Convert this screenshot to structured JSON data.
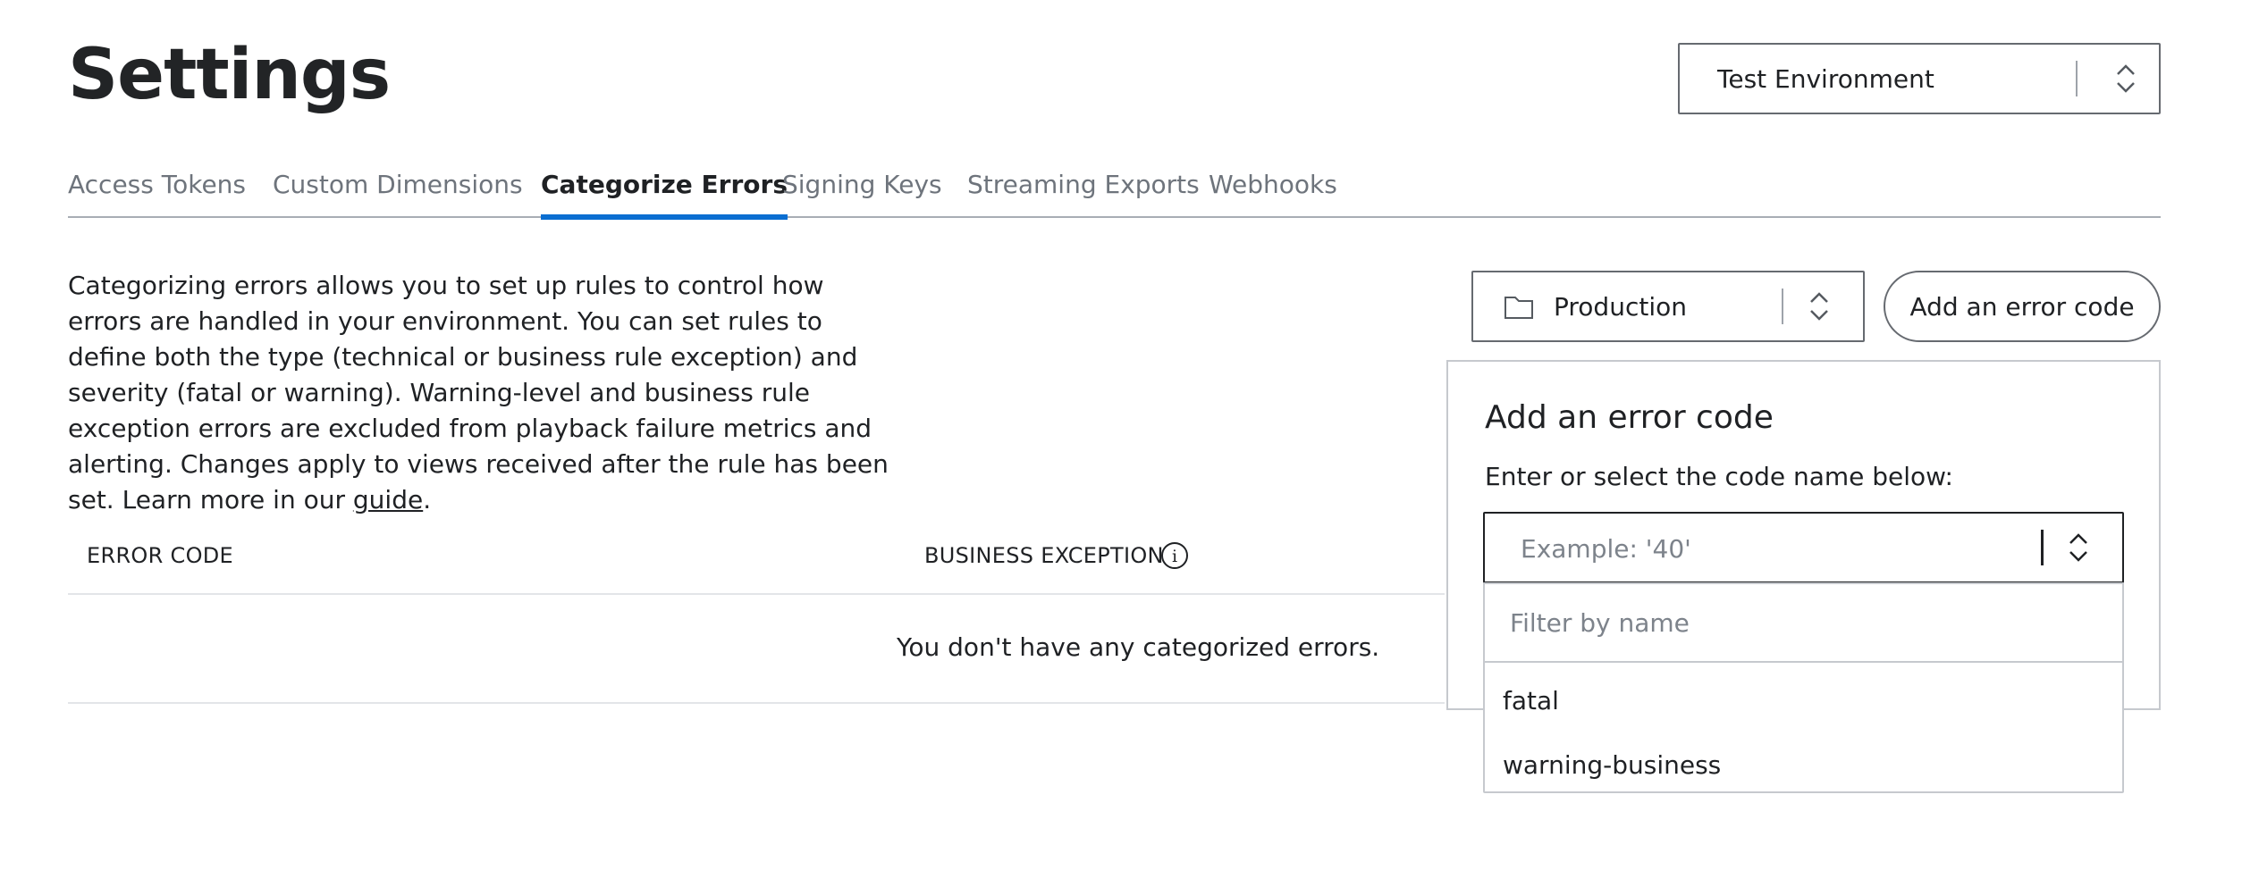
{
  "header": {
    "title": "Settings",
    "environment_select": {
      "value": "Test Environment"
    }
  },
  "tabs": [
    {
      "label": "Access Tokens",
      "active": false
    },
    {
      "label": "Custom Dimensions",
      "active": false
    },
    {
      "label": "Categorize Errors",
      "active": true
    },
    {
      "label": "Signing Keys",
      "active": false
    },
    {
      "label": "Streaming Exports",
      "active": false
    },
    {
      "label": "Webhooks",
      "active": false
    }
  ],
  "description": {
    "text": "Categorizing errors allows you to set up rules to control how errors are handled in your environment. You can set rules to define both the type (technical or business rule exception) and severity (fatal or warning). Warning-level and business rule exception errors are excluded from playback failure metrics and alerting. Changes apply to views received after the rule has been set. Learn more in our ",
    "link_text": "guide",
    "end": "."
  },
  "table": {
    "columns": [
      "ERROR CODE",
      "BUSINESS EXCEPTION"
    ],
    "empty_message": "You don't have any categorized errors."
  },
  "toolbar": {
    "property_select": {
      "value": "Production",
      "icon": "folder-icon"
    },
    "add_button_label": "Add an error code"
  },
  "add_panel": {
    "title": "Add an error code",
    "subtitle": "Enter or select the code name below:",
    "code_input": {
      "value": "",
      "placeholder": "Example: '40'"
    },
    "filter_input": {
      "value": "",
      "placeholder": "Filter by name"
    },
    "options": [
      "fatal",
      "warning-business"
    ]
  },
  "colors": {
    "accent": "#0a6ed1",
    "text": "#1f2124",
    "muted": "#6e747c",
    "border": "#666a70"
  }
}
